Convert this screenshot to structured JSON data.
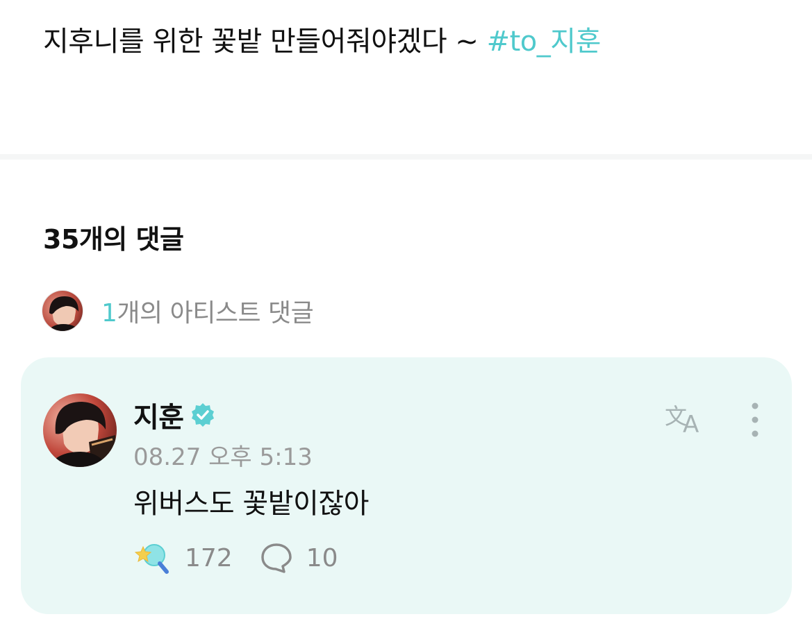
{
  "post": {
    "text": "지후니를 위한 꽃밭 만들어줘야겠다 ~ ",
    "hashtag": "#to_지훈"
  },
  "comments": {
    "count_label": "35개의 댓글",
    "artist_summary": {
      "count": "1",
      "label": "개의 아티스트 댓글",
      "avatar_icon": "artist-avatar"
    }
  },
  "artist_comment": {
    "author": "지훈",
    "verified_icon": "verified-badge-icon",
    "timestamp": "08.27 오후 5:13",
    "body": "위버스도 꽃밭이잖아",
    "likes": "172",
    "replies": "10",
    "translate_icon": "translate-icon",
    "more_icon": "more-vertical-icon",
    "like_icon": "star-wand-like-icon",
    "reply_icon": "speech-bubble-icon"
  },
  "colors": {
    "accent": "#4fc9cc",
    "card_background": "#eaf8f6",
    "muted_text": "#8a8a8a",
    "icon_gray": "#a7b3b4"
  }
}
